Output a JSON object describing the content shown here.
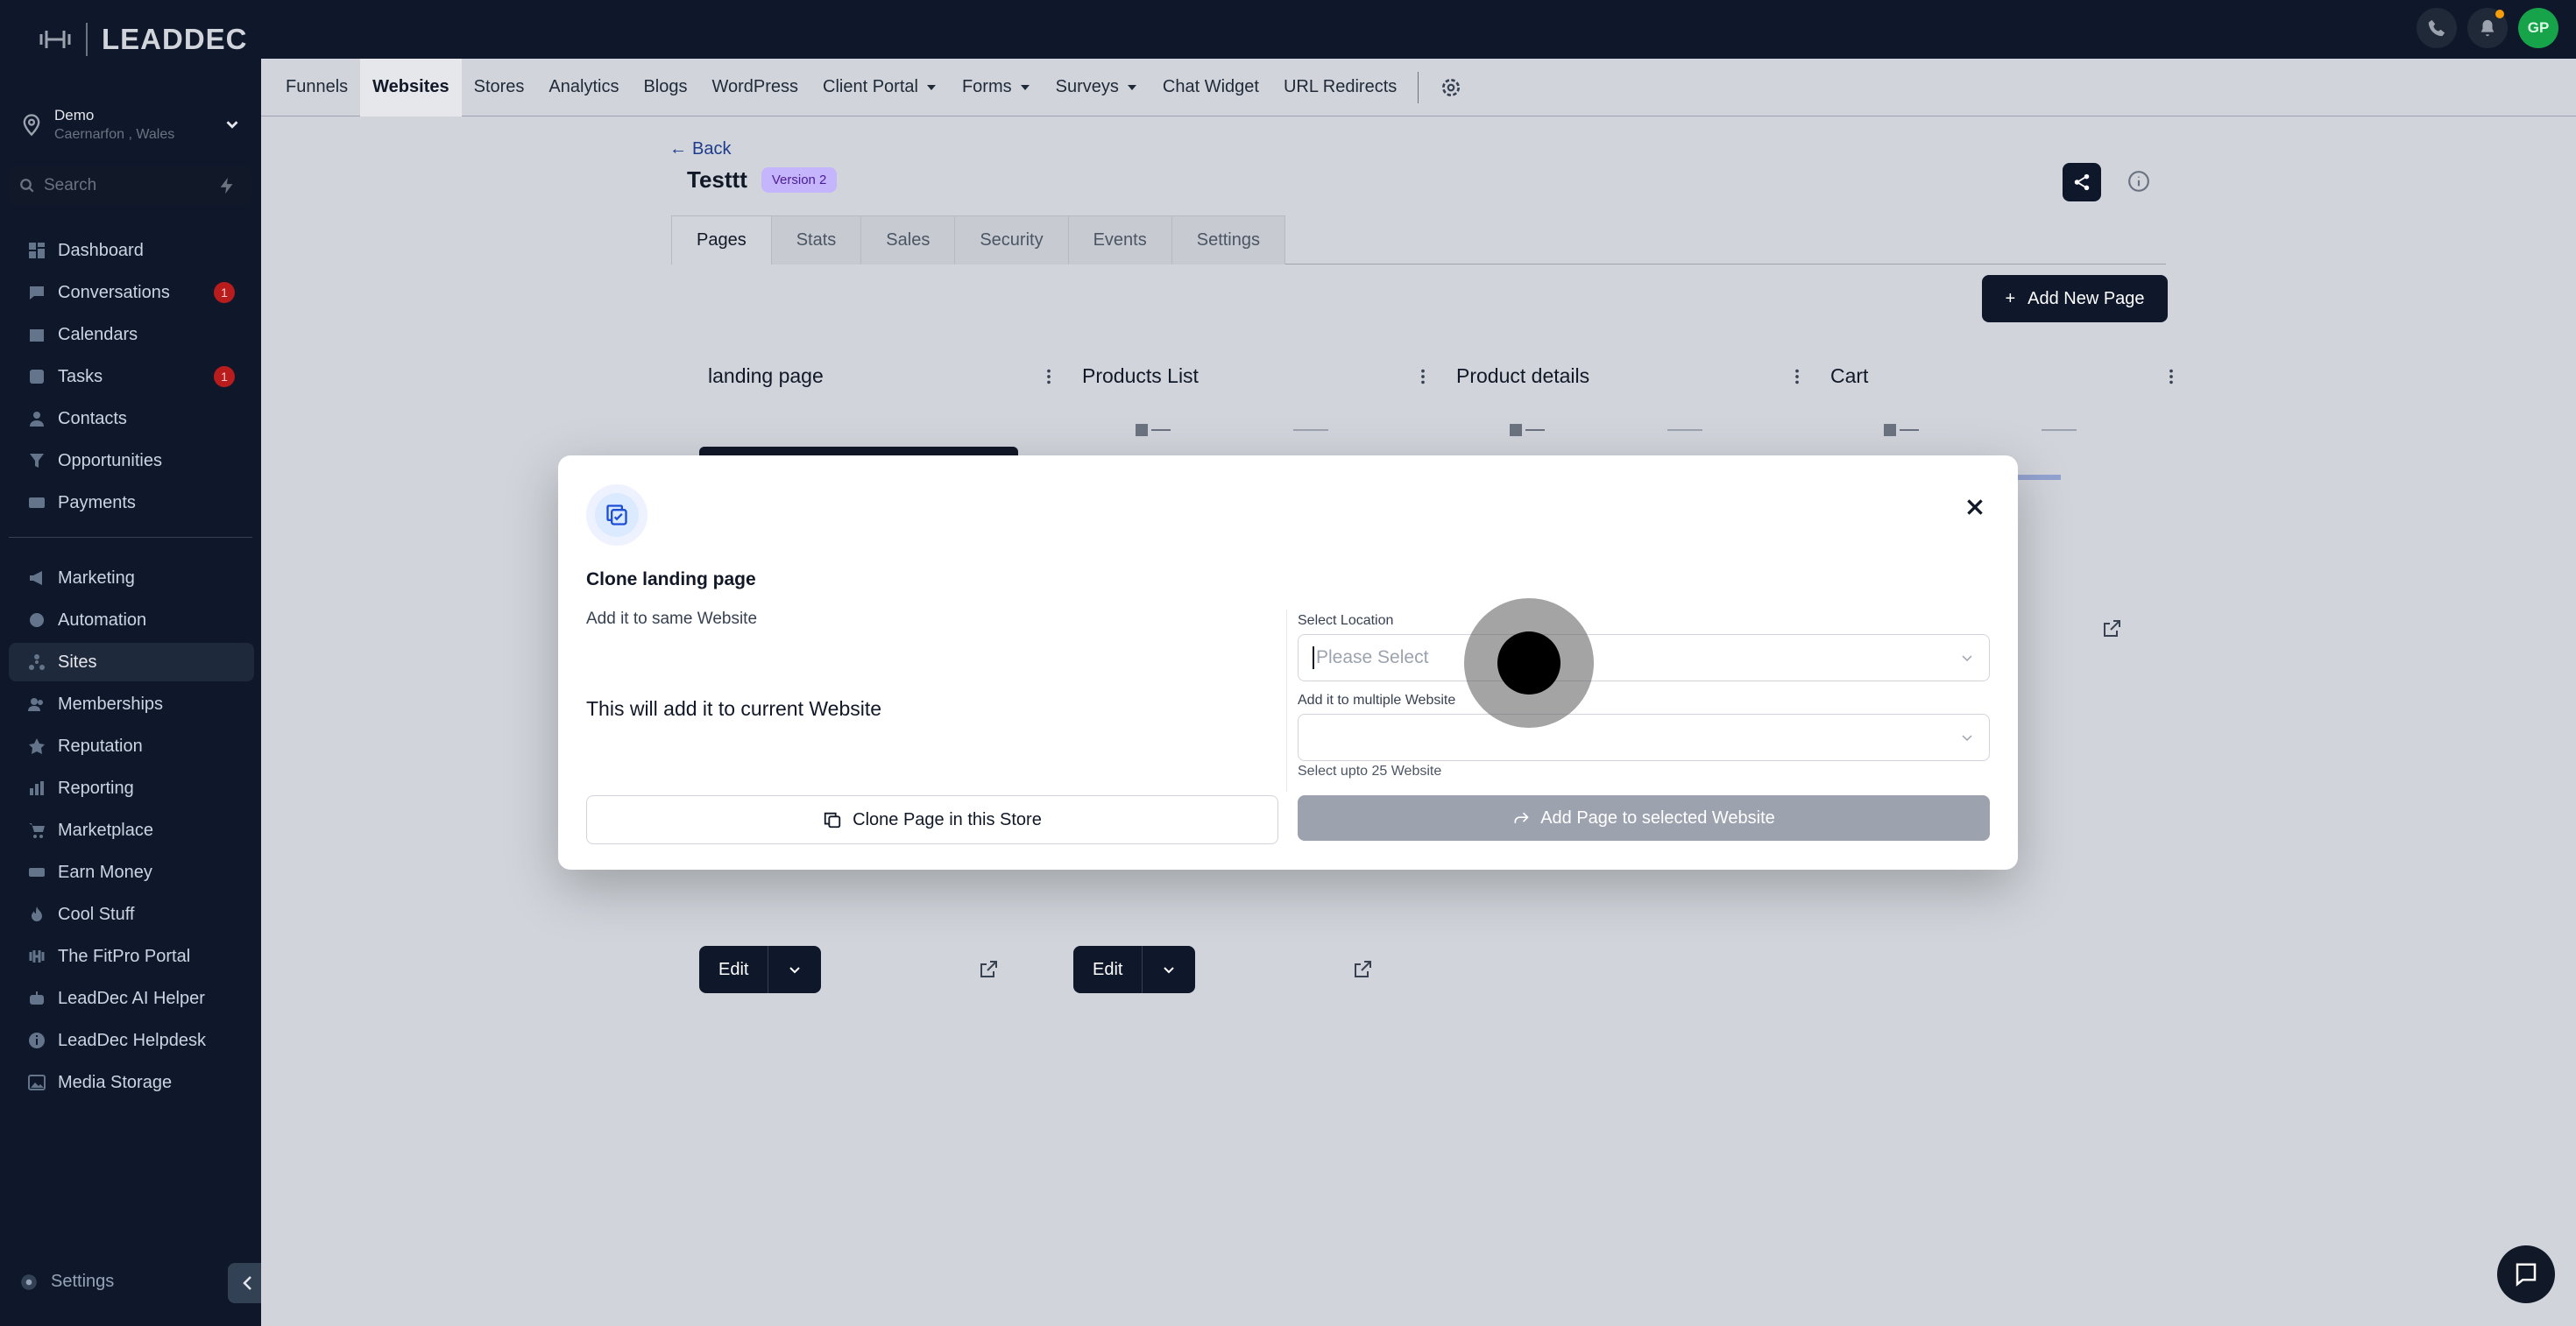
{
  "brand": {
    "name": "LEADDEC"
  },
  "location": {
    "name": "Demo",
    "address": "Caernarfon , Wales"
  },
  "search": {
    "placeholder": "Search"
  },
  "sidebar": {
    "items": [
      {
        "label": "Dashboard",
        "icon": "dashboard-icon"
      },
      {
        "label": "Conversations",
        "icon": "chat-icon",
        "badge": "1"
      },
      {
        "label": "Calendars",
        "icon": "calendar-icon"
      },
      {
        "label": "Tasks",
        "icon": "check-icon",
        "badge": "1"
      },
      {
        "label": "Contacts",
        "icon": "user-icon"
      },
      {
        "label": "Opportunities",
        "icon": "filter-icon"
      },
      {
        "label": "Payments",
        "icon": "card-icon"
      }
    ],
    "items2": [
      {
        "label": "Marketing",
        "icon": "megaphone-icon"
      },
      {
        "label": "Automation",
        "icon": "automation-icon"
      },
      {
        "label": "Sites",
        "icon": "sites-icon",
        "active": true
      },
      {
        "label": "Memberships",
        "icon": "memberships-icon"
      },
      {
        "label": "Reputation",
        "icon": "star-icon"
      },
      {
        "label": "Reporting",
        "icon": "chart-icon"
      },
      {
        "label": "Marketplace",
        "icon": "cart-icon"
      },
      {
        "label": "Earn Money",
        "icon": "money-icon"
      },
      {
        "label": "Cool Stuff",
        "icon": "fire-icon"
      },
      {
        "label": "The FitPro Portal",
        "icon": "dumbbell-icon"
      },
      {
        "label": "LeadDec AI Helper",
        "icon": "robot-icon"
      },
      {
        "label": "LeadDec Helpdesk",
        "icon": "info-icon"
      },
      {
        "label": "Media Storage",
        "icon": "image-icon"
      }
    ],
    "settings_label": "Settings"
  },
  "topbar": {
    "avatar_initials": "GP"
  },
  "subnav": {
    "tabs": [
      {
        "label": "Funnels"
      },
      {
        "label": "Websites",
        "active": true
      },
      {
        "label": "Stores"
      },
      {
        "label": "Analytics"
      },
      {
        "label": "Blogs"
      },
      {
        "label": "WordPress"
      },
      {
        "label": "Client Portal",
        "dropdown": true
      },
      {
        "label": "Forms",
        "dropdown": true
      },
      {
        "label": "Surveys",
        "dropdown": true
      },
      {
        "label": "Chat Widget"
      },
      {
        "label": "URL Redirects"
      }
    ]
  },
  "page": {
    "back_label": "Back",
    "site_title": "Testtt",
    "version_badge": "Version 2",
    "tabs": [
      "Pages",
      "Stats",
      "Sales",
      "Security",
      "Events",
      "Settings"
    ],
    "add_page_label": "Add New Page",
    "cards": [
      {
        "title": "landing page"
      },
      {
        "title": "Products List"
      },
      {
        "title": "Product details"
      },
      {
        "title": "Cart"
      }
    ],
    "edit_label": "Edit"
  },
  "modal": {
    "title": "Clone landing page",
    "subtitle": "Add it to same Website",
    "description": "This will add it to current Website",
    "clone_button": "Clone Page in this Store",
    "select_location_label": "Select Location",
    "select_location_placeholder": "Please Select",
    "multiple_label": "Add it to multiple Website",
    "hint": "Select upto 25 Website",
    "add_button": "Add Page to selected Website"
  },
  "colors": {
    "sidebar": "#0f172a",
    "accent": "#0f172a",
    "badge": "#b91c1c",
    "avatar": "#16a34a"
  }
}
